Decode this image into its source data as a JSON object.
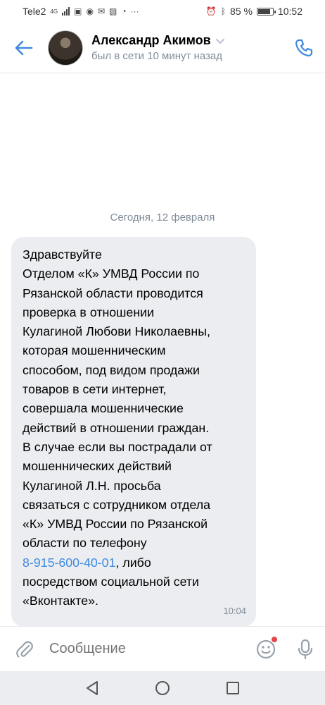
{
  "status_bar": {
    "carrier": "Tele2",
    "network": "4G",
    "battery": "85 %",
    "battery_level": 0.85,
    "time": "10:52"
  },
  "header": {
    "contact_name": "Александр Акимов",
    "contact_status": "был в сети 10 минут назад"
  },
  "chat": {
    "date_separator": "Сегодня, 12 февраля",
    "message": {
      "lines": [
        "Здравствуйте",
        "Отделом «К» УМВД России по",
        "Рязанской области проводится",
        "проверка в отношении",
        "Кулагиной Любови Николаевны,",
        "которая мошенническим",
        "способом, под видом продажи",
        "товаров в сети интернет,",
        "совершала мошеннические",
        "действий в отношении граждан.",
        "В случае если вы пострадали от",
        "мошеннических действий",
        "Кулагиной Л.Н. просьба",
        "связаться с сотрудником отдела",
        "«К» УМВД России по Рязанской",
        "области по телефону"
      ],
      "phone_link": "8-915-600-40-01",
      "phone_suffix": ", либо",
      "tail_lines": [
        "посредством социальной сети",
        "«Вконтакте»."
      ],
      "time": "10:04"
    }
  },
  "composer": {
    "placeholder": "Сообщение"
  },
  "colors": {
    "accent": "#3f8ae0",
    "bubble": "#ebedf0",
    "secondary_text": "#818c99",
    "badge": "#e64646"
  }
}
